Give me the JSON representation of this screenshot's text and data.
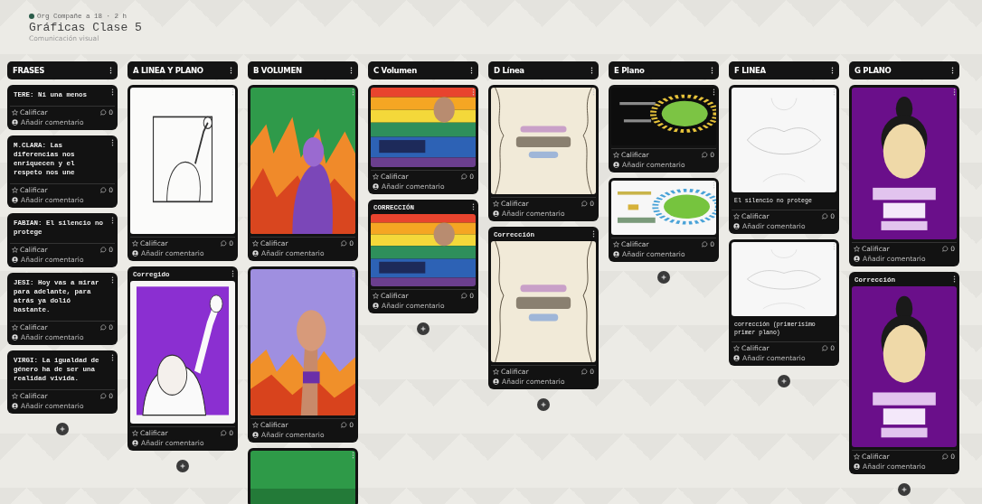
{
  "board": {
    "author": "Org Compañe a 18 · 2 h",
    "title": "Gráficas Clase 5",
    "subtitle": "Comunicación visual"
  },
  "columns": [
    {
      "title": "FRASES",
      "posts": [
        {
          "kind": "text",
          "body": "TERE: Ni una menos",
          "rating_label": "Calificar",
          "comment_count": "0",
          "comment_prompt": "Añadir comentario"
        },
        {
          "kind": "text",
          "body": "M.CLARA: Las diferencias nos enriquecen y el respeto nos une",
          "rating_label": "Calificar",
          "comment_count": "0",
          "comment_prompt": "Añadir comentario"
        },
        {
          "kind": "text",
          "body": "FABIAN: El silencio no protege",
          "rating_label": "Calificar",
          "comment_count": "0",
          "comment_prompt": "Añadir comentario"
        },
        {
          "kind": "text",
          "body": "JESI: Hoy vas a mirar para adelante, para atrás ya dolió bastante.",
          "rating_label": "Calificar",
          "comment_count": "0",
          "comment_prompt": "Añadir comentario"
        },
        {
          "kind": "text",
          "body": "VIRGI: La igualdad de género ha de ser una realidad vivida.",
          "rating_label": "Calificar",
          "comment_count": "0",
          "comment_prompt": "Añadir comentario"
        }
      ]
    },
    {
      "title": "A LINEA Y PLANO",
      "posts": [
        {
          "kind": "picture",
          "rating_label": "Calificar",
          "comment_count": "0",
          "comment_prompt": "Añadir comentario"
        },
        {
          "kind": "picture",
          "title": "Corregido",
          "rating_label": "Calificar",
          "comment_count": "0",
          "comment_prompt": "Añadir comentario"
        }
      ]
    },
    {
      "title": "B VOLUMEN",
      "posts": [
        {
          "kind": "picture",
          "rating_label": "Calificar",
          "comment_count": "0",
          "comment_prompt": "Añadir comentario"
        },
        {
          "kind": "picture",
          "rating_label": "Calificar",
          "comment_count": "0",
          "comment_prompt": "Añadir comentario"
        },
        {
          "kind": "picture"
        }
      ]
    },
    {
      "title": "C Volumen",
      "posts": [
        {
          "kind": "picture",
          "rating_label": "Calificar",
          "comment_count": "0",
          "comment_prompt": "Añadir comentario"
        },
        {
          "kind": "picture",
          "title": "CORRECCIÓN",
          "rating_label": "Calificar",
          "comment_count": "0",
          "comment_prompt": "Añadir comentario"
        }
      ]
    },
    {
      "title": "D Línea",
      "posts": [
        {
          "kind": "picture",
          "rating_label": "Calificar",
          "comment_count": "0",
          "comment_prompt": "Añadir comentario"
        },
        {
          "kind": "picture",
          "title": "Corrección",
          "rating_label": "Calificar",
          "comment_count": "0",
          "comment_prompt": "Añadir comentario"
        }
      ]
    },
    {
      "title": "E Plano",
      "posts": [
        {
          "kind": "picture",
          "rating_label": "Calificar",
          "comment_count": "0",
          "comment_prompt": "Añadir comentario"
        },
        {
          "kind": "picture",
          "rating_label": "Calificar",
          "comment_count": "0",
          "comment_prompt": "Añadir comentario"
        }
      ]
    },
    {
      "title": "F LINEA",
      "posts": [
        {
          "kind": "picture",
          "caption": "El silencio no protege",
          "rating_label": "Calificar",
          "comment_count": "0",
          "comment_prompt": "Añadir comentario"
        },
        {
          "kind": "picture",
          "caption": "corrección (primerísimo primer plano)",
          "rating_label": "Calificar",
          "comment_count": "0",
          "comment_prompt": "Añadir comentario"
        }
      ]
    },
    {
      "title": "G PLANO",
      "posts": [
        {
          "kind": "picture",
          "rating_label": "Calificar",
          "comment_count": "0",
          "comment_prompt": "Añadir comentario"
        },
        {
          "kind": "picture",
          "title": "Corrección",
          "rating_label": "Calificar",
          "comment_count": "0",
          "comment_prompt": "Añadir comentario"
        }
      ]
    }
  ]
}
